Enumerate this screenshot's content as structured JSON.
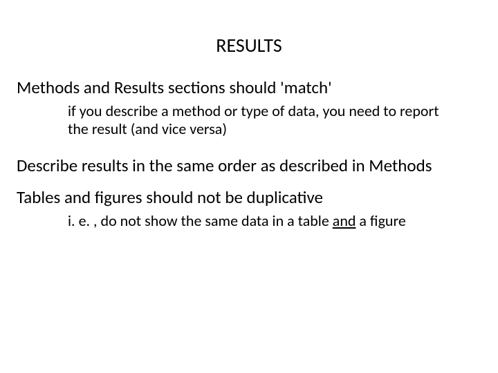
{
  "title": "RESULTS",
  "points": {
    "p1": "Methods and Results sections should 'match'",
    "p1_sub": "if you describe a method or type of data, you need to report the result (and vice versa)",
    "p2": "Describe results in the same order as described in Methods",
    "p3": "Tables and figures should not be duplicative",
    "p3_sub_pre": "i. e. , do not show the same data in a table ",
    "p3_sub_u": "and",
    "p3_sub_post": " a figure"
  }
}
